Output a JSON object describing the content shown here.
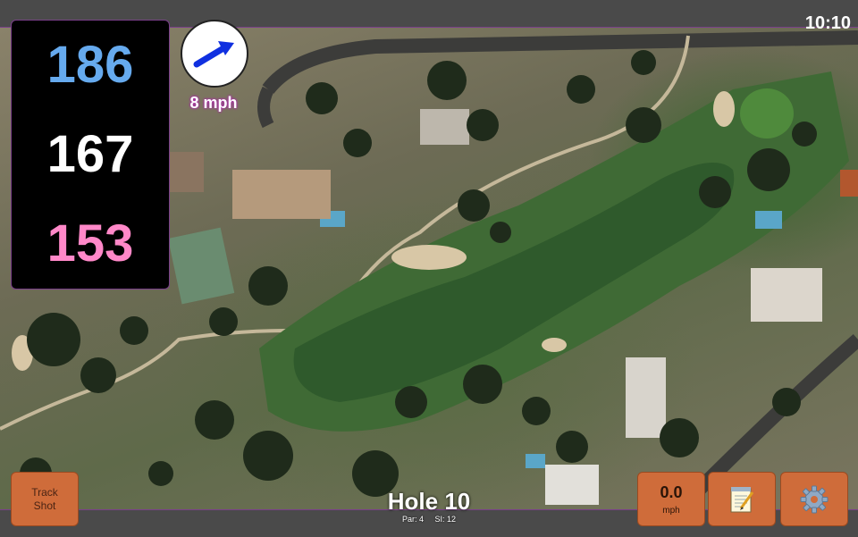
{
  "status": {
    "time": "10:10"
  },
  "yardages": {
    "back": "186",
    "middle": "167",
    "front": "153"
  },
  "wind": {
    "speed_label": "8 mph",
    "arrow_icon": "wind-direction-arrow-icon"
  },
  "buttons": {
    "track_shot_line1": "Track",
    "track_shot_line2": "Shot",
    "wind_value": "0.0",
    "wind_unit": "mph",
    "notes_icon": "notepad-icon",
    "settings_icon": "gear-icon"
  },
  "hole": {
    "title": "Hole 10",
    "par": "Par: 4",
    "si": "SI: 12"
  },
  "colors": {
    "back": "#66aaee",
    "middle": "#ffffff",
    "front": "#ff88c8",
    "button": "#cf6c3a",
    "accent": "#7a3f8a"
  }
}
